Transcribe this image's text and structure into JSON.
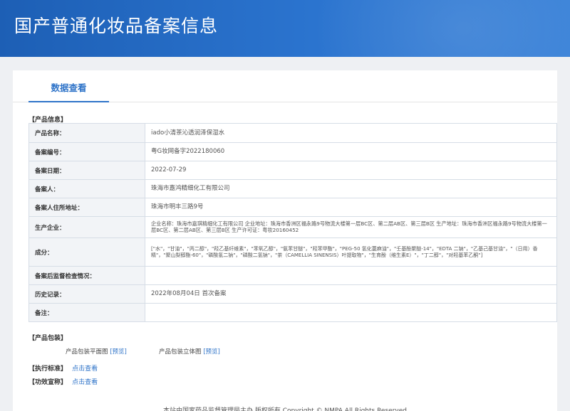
{
  "header": {
    "title": "国产普通化妆品备案信息"
  },
  "tabs": [
    {
      "label": "数据查看"
    }
  ],
  "product_section": {
    "title": "【产品信息】"
  },
  "rows": [
    {
      "label": "产品名称：",
      "value": "iado小清茶沁透润泽保湿水"
    },
    {
      "label": "备案编号：",
      "value": "粤G妆网备字2022180060"
    },
    {
      "label": "备案日期：",
      "value": "2022-07-29"
    },
    {
      "label": "备案人：",
      "value": "珠海市嘉鸿精细化工有限公司"
    },
    {
      "label": "备案人住所地址：",
      "value": "珠海市明丰三路9号"
    },
    {
      "label": "生产企业：",
      "value": "企业名称：珠海市嘉琪精细化工有限公司 企业地址：珠海市香洲区福永路9号物流大楼第一层BC区、第二层AB区、第三层B区 生产地址：珠海市香洲区福永路9号物流大楼第一层BC区、第二层AB区、第三层B区 生产许可证：粤妆20160452"
    },
    {
      "label": "成分：",
      "value": "[\"水\"，\"甘油\"，\"丙二醇\"，\"羟乙基纤维素\"，\"苯氧乙醇\"，\"氨苯甘醚\"，\"羟苯甲酯\"，\"PEG-50 氢化蓖麻油\"，\"壬基酚聚醚-14\"，\"EDTA 二钠\"，\"乙基己基甘油\"，\"（日用）香精\"，\"聚山梨醇酯-60\"，\"磷酸氢二钠\"，\"磷酸二氢钠\"，\"茶（CAMELLIA SINENSIS）叶提取物\"，\"生育酚（维生素E）\"，\"丁二醇\"，\"对羟基苯乙酮\"]"
    },
    {
      "label": "备案后监督检查情况：",
      "value": ""
    },
    {
      "label": "历史记录：",
      "value": "2022年08月04日 首次备案"
    },
    {
      "label": "备注：",
      "value": ""
    }
  ],
  "packaging": {
    "title": "【产品包装】",
    "flat_label": "产品包装平面图",
    "flat_link": "[预览]",
    "solid_label": "产品包装立体图",
    "solid_link": "[预览]"
  },
  "standard": {
    "title": "【执行标准】",
    "link": "点击查看"
  },
  "efficacy": {
    "title": "【功效宣称】",
    "link": "点击查看"
  },
  "footer": {
    "text": "本站由国家药品监督管理局主办 版权所有 Copyright © NMPA All Rights Reserved"
  },
  "colors": {
    "banner": "#2566c2",
    "accent": "#2e73c8",
    "page_bg": "#eef0f3",
    "label_bg": "#f2f4f7",
    "border": "#d6dde6"
  }
}
